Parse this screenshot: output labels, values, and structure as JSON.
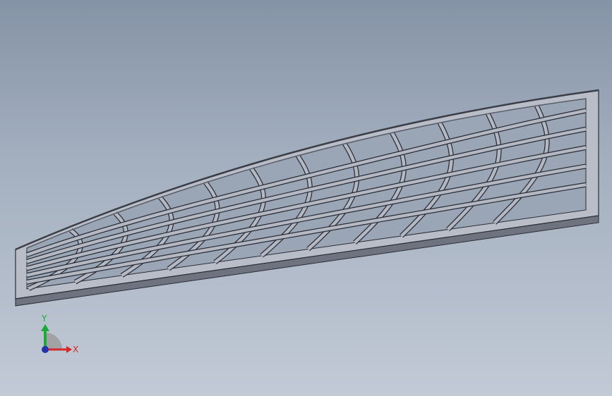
{
  "model": {
    "part_name": "",
    "grid_columns": 12,
    "grid_rows": 6
  },
  "triad": {
    "x_label": "X",
    "y_label": "Y",
    "x_color": "#d62828",
    "y_color": "#1fa83a",
    "z_color": "#2233aa"
  },
  "colors": {
    "face_top": "#b8bcc6",
    "face_side": "#7b7f8b",
    "edge": "#2a2d36",
    "background_top": "#8593a6",
    "background_bottom": "#c2cad6"
  }
}
